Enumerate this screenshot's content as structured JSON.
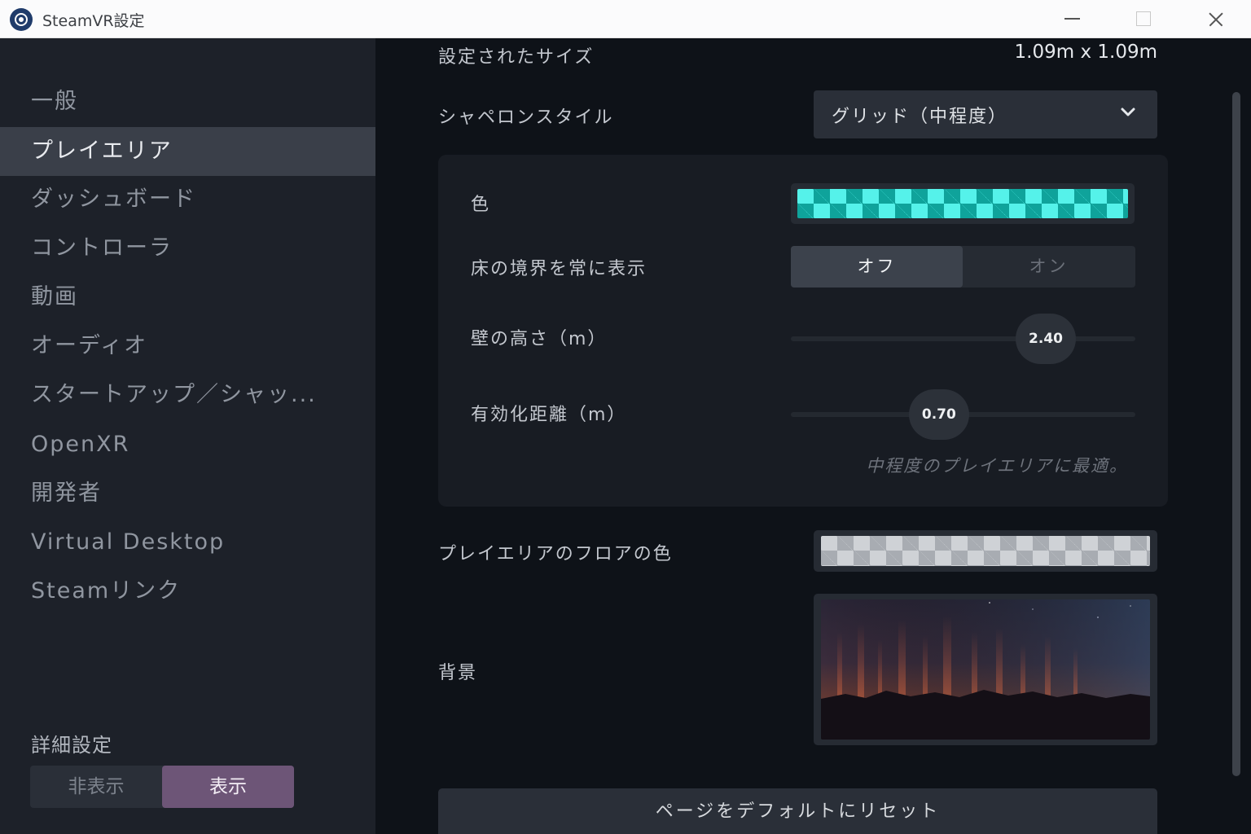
{
  "window": {
    "title": "SteamVR設定",
    "icon": "steamvr-gear-icon"
  },
  "sidebar": {
    "items": [
      {
        "label": "一般",
        "active": false
      },
      {
        "label": "プレイエリア",
        "active": true
      },
      {
        "label": "ダッシュボード",
        "active": false
      },
      {
        "label": "コントローラ",
        "active": false
      },
      {
        "label": "動画",
        "active": false
      },
      {
        "label": "オーディオ",
        "active": false
      },
      {
        "label": "スタートアップ／シャッ...",
        "active": false
      },
      {
        "label": "OpenXR",
        "active": false
      },
      {
        "label": "開発者",
        "active": false
      },
      {
        "label": "Virtual Desktop",
        "active": false
      },
      {
        "label": "Steamリンク",
        "active": false
      }
    ],
    "advanced": {
      "label": "詳細設定",
      "options": [
        "非表示",
        "表示"
      ],
      "selected": "表示"
    }
  },
  "main": {
    "size": {
      "label": "設定されたサイズ",
      "value": "1.09m x 1.09m"
    },
    "chaperone_style": {
      "label": "シャペロンスタイル",
      "selected": "グリッド（中程度）"
    },
    "color": {
      "label": "色",
      "colors": [
        "#55f2ea",
        "#0fa39b"
      ]
    },
    "floor_bounds": {
      "label": "床の境界を常に表示",
      "options": [
        "オフ",
        "オン"
      ],
      "selected": "オフ"
    },
    "wall_height": {
      "label": "壁の高さ（m）",
      "value": "2.40",
      "position": 0.74
    },
    "activation_distance": {
      "label": "有効化距離（m）",
      "value": "0.70",
      "position": 0.43
    },
    "hint": "中程度のプレイエリアに最適。",
    "floor_color": {
      "label": "プレイエリアのフロアの色",
      "colors": [
        "#a8acb2",
        "#2a2f37"
      ]
    },
    "background": {
      "label": "背景",
      "image": "aurora-mountains-night"
    },
    "reset_label": "ページをデフォルトにリセット"
  }
}
